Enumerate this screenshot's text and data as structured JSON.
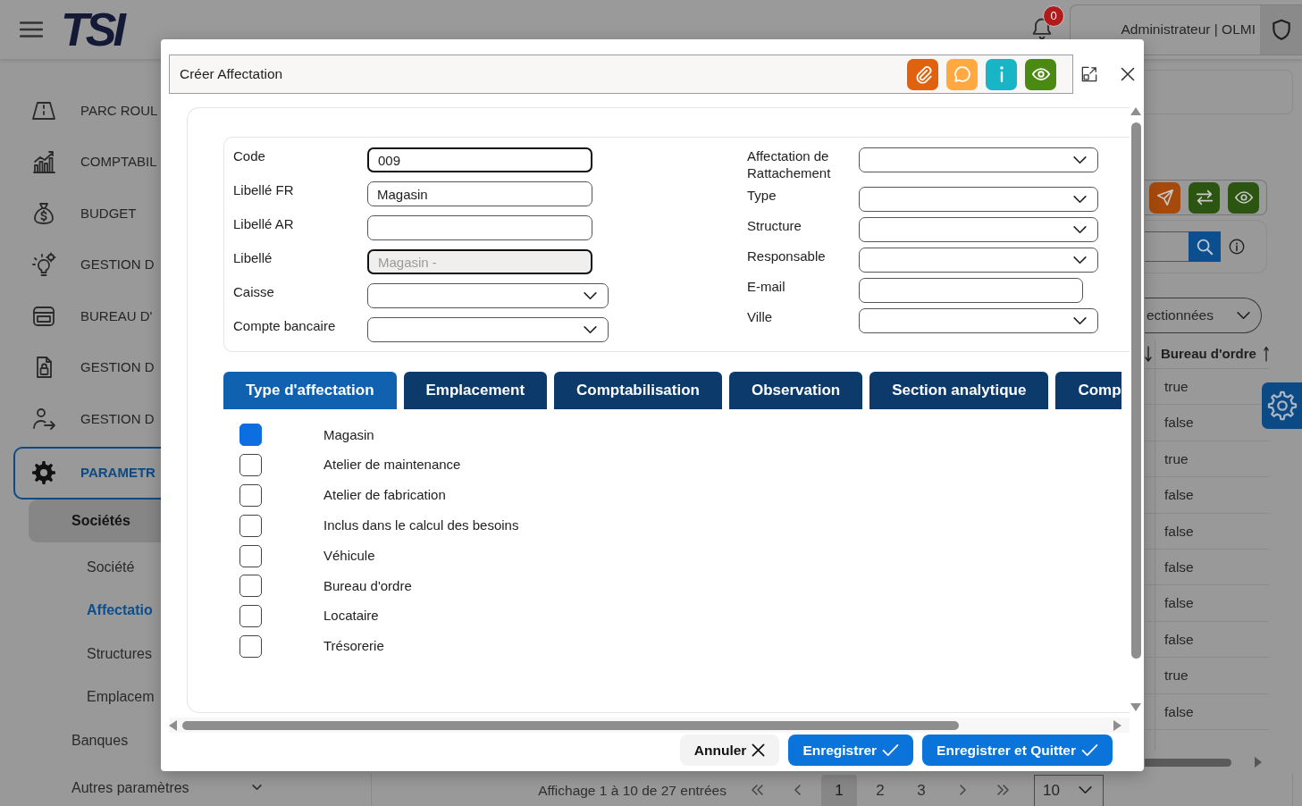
{
  "header": {
    "logo": "TSI",
    "notification_count": "0",
    "user": "Administrateur | OLMI"
  },
  "sidebar": {
    "items": [
      {
        "label": "PARC ROUL",
        "expanded": false
      },
      {
        "label": "COMPTABIL",
        "expanded": false
      },
      {
        "label": "BUDGET",
        "expanded": false
      },
      {
        "label": "GESTION D",
        "expanded": false
      },
      {
        "label": "BUREAU D'",
        "expanded": false
      },
      {
        "label": "GESTION D",
        "expanded": false
      },
      {
        "label": "GESTION D",
        "expanded": false
      },
      {
        "label": "PARAMETR",
        "expanded": true,
        "children": [
          {
            "label": "Sociétés",
            "expanded": true,
            "children": [
              {
                "label": "Société",
                "selected": false
              },
              {
                "label": "Affectatio",
                "selected": true
              },
              {
                "label": "Structures",
                "selected": false
              },
              {
                "label": "Emplacem",
                "selected": false
              }
            ]
          },
          {
            "label": "Banques"
          },
          {
            "label": "Autres paramètres",
            "expanded": false
          }
        ]
      }
    ]
  },
  "main": {
    "toolbar_buttons": [
      {
        "color": "#a5490c"
      },
      {
        "color": "#2c5512"
      },
      {
        "color": "#2c5512"
      }
    ],
    "filter": {
      "value": "ectionnées"
    },
    "table": {
      "columns": [
        "Bureau d'ordre"
      ],
      "rows": [
        [
          "true"
        ],
        [
          "false"
        ],
        [
          "true"
        ],
        [
          "false"
        ],
        [
          "false"
        ],
        [
          "false"
        ],
        [
          "false"
        ],
        [
          "false"
        ],
        [
          "true"
        ],
        [
          "false"
        ]
      ]
    },
    "pagination": {
      "summary": "Affichage 1 à 10 de 27 entrées",
      "pages": [
        {
          "label": "1",
          "selected": true
        },
        {
          "label": "2",
          "selected": false
        },
        {
          "label": "3",
          "selected": false
        }
      ],
      "page_size": "10"
    }
  },
  "modal": {
    "title": "Créer Affectation",
    "header_buttons": [
      {
        "color": "#e0620f"
      },
      {
        "color": "#ffa940"
      },
      {
        "color": "#17b5c6"
      },
      {
        "color": "#4b8a12"
      }
    ],
    "form": {
      "left": [
        {
          "label": "Code",
          "kind": "input",
          "value": "009",
          "highlighted": true,
          "disabled": false
        },
        {
          "label": "Libellé FR",
          "kind": "input",
          "value": "Magasin",
          "highlighted": false,
          "disabled": false
        },
        {
          "label": "Libellé AR",
          "kind": "input",
          "highlighted": false,
          "disabled": false
        },
        {
          "label": "Libellé",
          "kind": "input",
          "value": "Magasin -",
          "highlighted": true,
          "disabled": true
        },
        {
          "label": "Caisse",
          "kind": "select",
          "highlighted": false,
          "disabled": false
        },
        {
          "label": "Compte bancaire",
          "kind": "select",
          "highlighted": false,
          "disabled": false
        }
      ],
      "right": [
        {
          "label": "Affectation de Rattachement",
          "kind": "select",
          "highlighted": false,
          "disabled": false
        },
        {
          "label": "Type",
          "kind": "select",
          "highlighted": false,
          "disabled": false
        },
        {
          "label": "Structure",
          "kind": "select",
          "highlighted": false,
          "disabled": false
        },
        {
          "label": "Responsable",
          "kind": "select",
          "highlighted": false,
          "disabled": false
        },
        {
          "label": "E-mail",
          "kind": "input",
          "highlighted": false,
          "disabled": false
        },
        {
          "label": "Ville",
          "kind": "select",
          "highlighted": false,
          "disabled": false
        }
      ]
    },
    "tabs": [
      {
        "label": "Type d'affectation",
        "selected": true
      },
      {
        "label": "Emplacement",
        "selected": false
      },
      {
        "label": "Comptabilisation",
        "selected": false
      },
      {
        "label": "Observation",
        "selected": false
      },
      {
        "label": "Section analytique",
        "selected": false
      },
      {
        "label": "Comp",
        "selected": false
      }
    ],
    "types": [
      {
        "label": "Magasin",
        "checked": true
      },
      {
        "label": "Atelier de maintenance",
        "checked": false
      },
      {
        "label": "Atelier de fabrication",
        "checked": false
      },
      {
        "label": "Inclus dans le calcul des besoins",
        "checked": false
      },
      {
        "label": "Véhicule",
        "checked": false
      },
      {
        "label": "Bureau d'ordre",
        "checked": false
      },
      {
        "label": "Locataire",
        "checked": false
      },
      {
        "label": "Trésorerie",
        "checked": false
      }
    ],
    "buttons": [
      {
        "label": "Annuler",
        "kind": "cancel"
      },
      {
        "label": "Enregistrer",
        "kind": "confirm"
      },
      {
        "label": "Enregistrer et Quitter",
        "kind": "confirm"
      }
    ]
  }
}
